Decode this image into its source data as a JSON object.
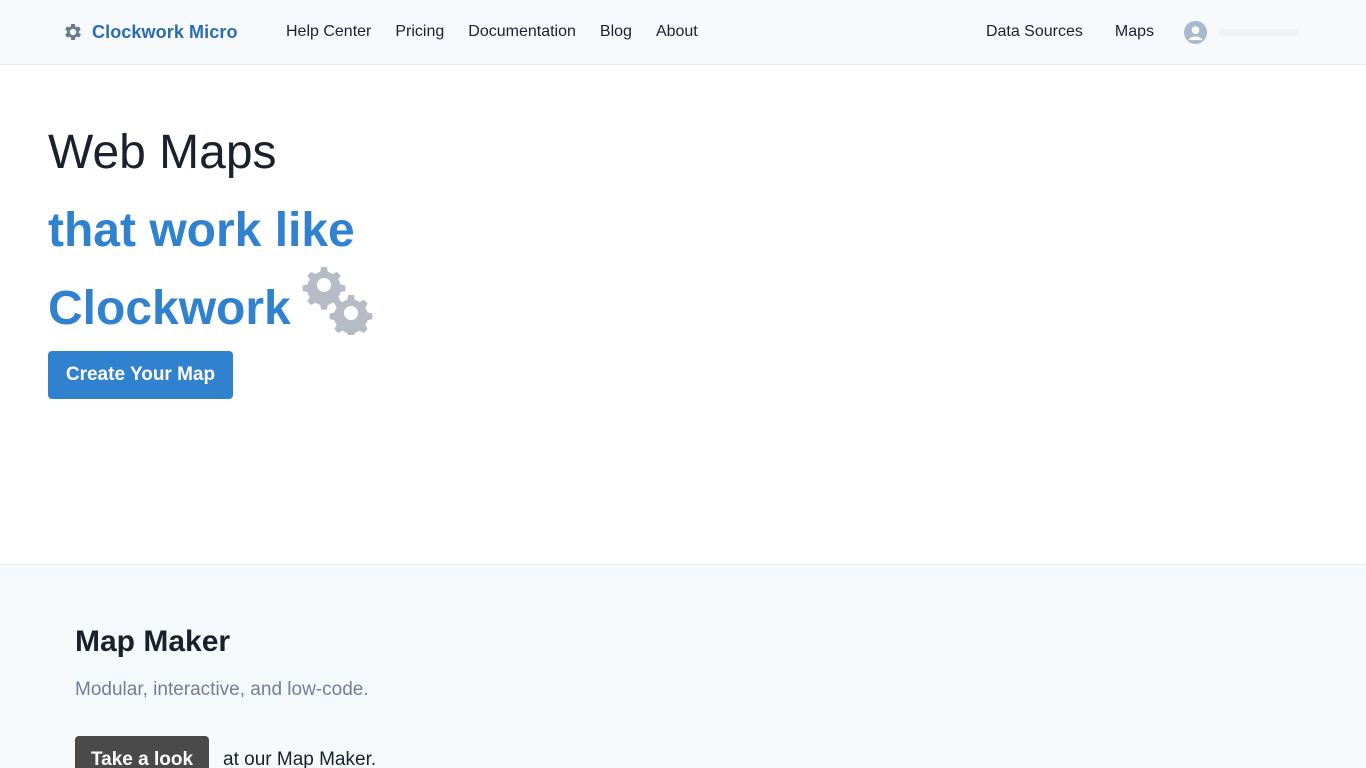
{
  "navbar": {
    "brand": {
      "text": "Clockwork Micro",
      "icon": "gear-icon",
      "color": "#2b6cb0"
    },
    "left_links": [
      "Help Center",
      "Pricing",
      "Documentation",
      "Blog",
      "About"
    ],
    "right_links": [
      "Data Sources",
      "Maps"
    ],
    "user": {
      "icon": "user-avatar-icon"
    }
  },
  "hero": {
    "title": "Web Maps",
    "subtitle_line1": "that work like",
    "subtitle_line2": "Clockwork",
    "decoration_icon": "gears-icon",
    "cta_label": "Create Your Map",
    "accent_color": "#3182ce"
  },
  "section": {
    "title": "Map Maker",
    "description": "Modular, interactive, and low-code.",
    "button_label": "Take a look",
    "button_suffix": "at our Map Maker."
  }
}
